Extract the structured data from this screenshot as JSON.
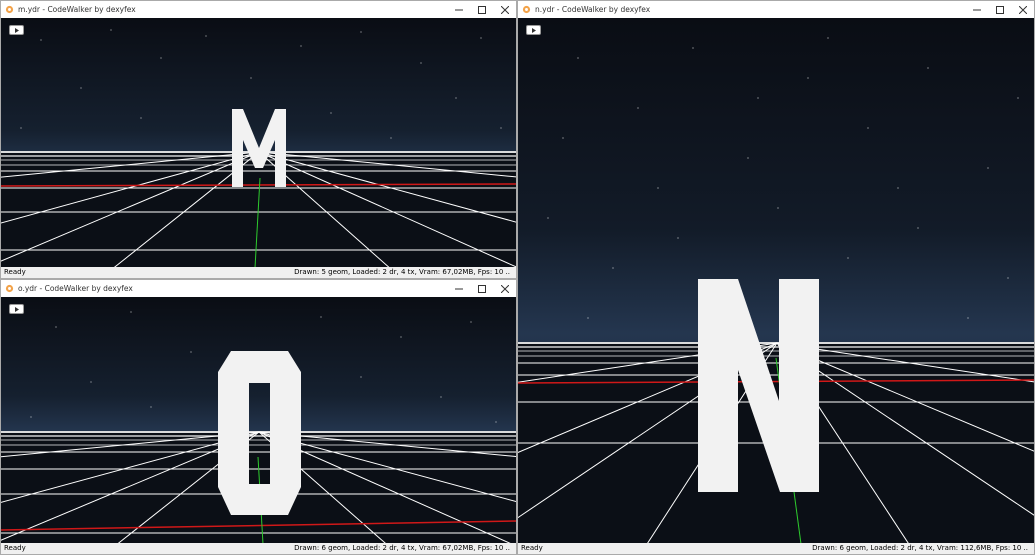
{
  "windows": {
    "m": {
      "title": "m.ydr - CodeWalker by dexyfex",
      "status_left": "Ready",
      "status_right": "Drawn: 5 geom, Loaded: 2 dr, 4 tx, Vram: 67,02MB, Fps: 10 ..",
      "letter": "M"
    },
    "o": {
      "title": "o.ydr - CodeWalker by dexyfex",
      "status_left": "Ready",
      "status_right": "Drawn: 6 geom, Loaded: 2 dr, 4 tx, Vram: 67,02MB, Fps: 10 ..",
      "letter": "O"
    },
    "n": {
      "title": "n.ydr - CodeWalker by dexyfex",
      "status_left": "Ready",
      "status_right": "Drawn: 6 geom, Loaded: 2 dr, 4 tx, Vram: 112,6MB, Fps: 10 ..",
      "letter": "N"
    }
  },
  "controls": {
    "minimize": "–",
    "maximize": "☐",
    "close": "✕"
  },
  "colors": {
    "sky_top": "#0a0d14",
    "sky_horizon": "#24364f",
    "grid": "#ffffff",
    "red_axis": "#d01818",
    "green_axis": "#2ecc2e",
    "letter": "#f2f2f2"
  },
  "icons": {
    "app": "codewalker-icon",
    "play": "play-icon"
  }
}
